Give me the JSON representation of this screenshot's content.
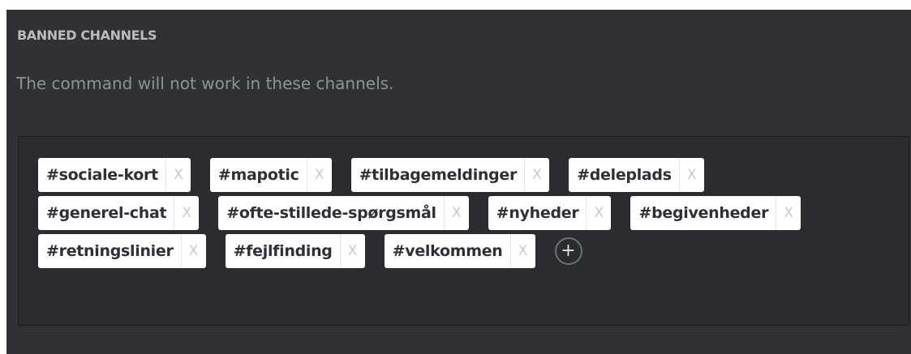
{
  "section": {
    "title": "BANNED CHANNELS",
    "description": "The command will not work in these channels."
  },
  "rows": [
    [
      {
        "label": "#sociale-kort",
        "remove": "X"
      },
      {
        "label": "#mapotic",
        "remove": "X"
      },
      {
        "label": "#tilbagemeldinger",
        "remove": "X"
      },
      {
        "label": "#deleplads",
        "remove": "X"
      }
    ],
    [
      {
        "label": "#generel-chat",
        "remove": "X"
      },
      {
        "label": "#ofte-stillede-spørgsmål",
        "remove": "X"
      },
      {
        "label": "#nyheder",
        "remove": "X"
      },
      {
        "label": "#begivenheder",
        "remove": "X"
      }
    ],
    [
      {
        "label": "#retningslinier",
        "remove": "X"
      },
      {
        "label": "#fejlfinding",
        "remove": "X"
      },
      {
        "label": "#velkommen",
        "remove": "X"
      }
    ]
  ],
  "add_button": {
    "label": "+",
    "icon": "plus-icon"
  },
  "colors": {
    "page_bg": "#ffffff",
    "panel_bg": "#2f3136",
    "box_bg": "#2a2c30",
    "tag_bg": "#ffffff",
    "tag_text": "#2e3036",
    "title_text": "#b9bbbe",
    "desc_text": "#8e9297"
  }
}
